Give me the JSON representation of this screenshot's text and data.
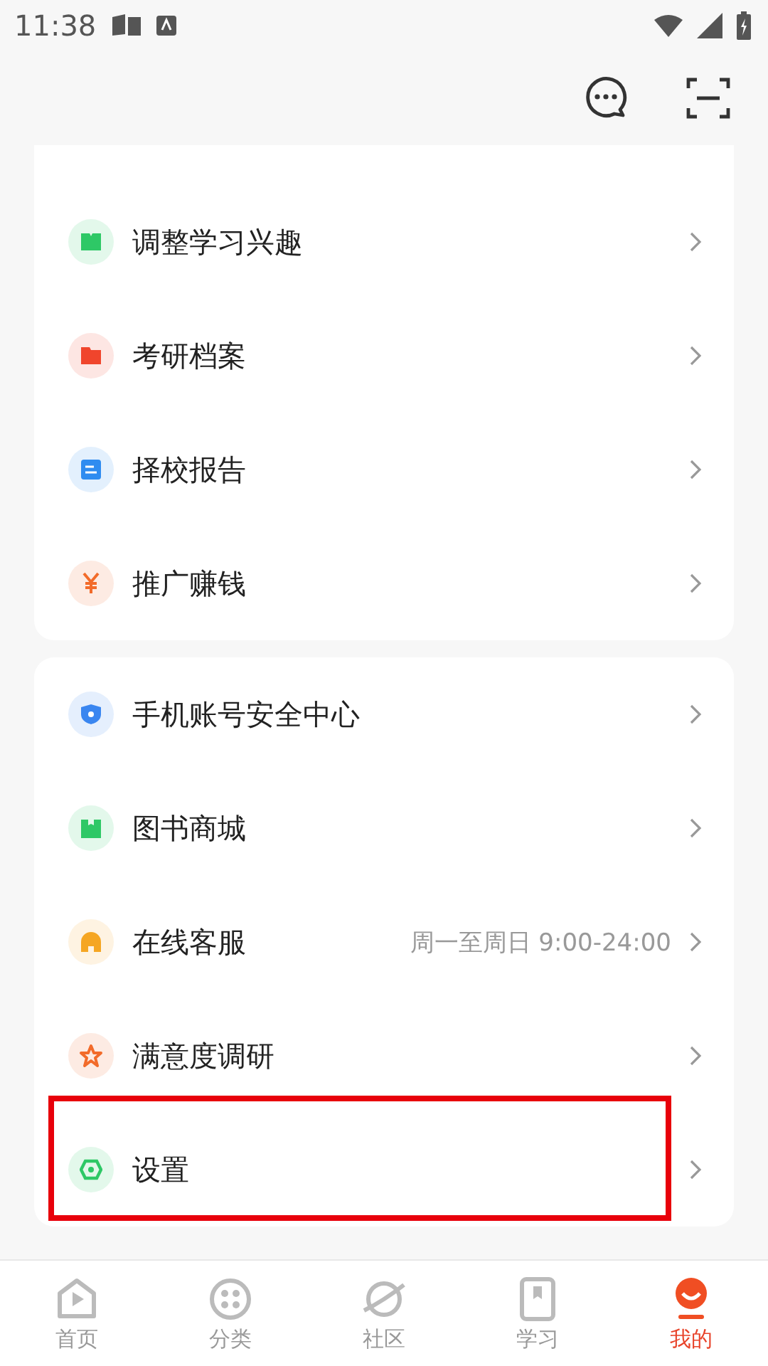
{
  "status_bar": {
    "time": "11:38"
  },
  "group_1": [
    {
      "label": "调整学习兴趣",
      "color": "#2ec866"
    },
    {
      "label": "考研档案",
      "color": "#f0452c"
    },
    {
      "label": "择校报告",
      "color": "#2f8cf0"
    },
    {
      "label": "推广赚钱",
      "color": "#f26b2a"
    }
  ],
  "group_2": [
    {
      "label": "手机账号安全中心",
      "color": "#3a86f0",
      "highlighted": false
    },
    {
      "label": "图书商城",
      "color": "#2ec866",
      "highlighted": false
    },
    {
      "label": "在线客服",
      "color": "#f5a623",
      "detail": "周一至周日 9:00-24:00",
      "highlighted": false
    },
    {
      "label": "满意度调研",
      "color": "#f26b2a",
      "highlighted": false
    },
    {
      "label": "设置",
      "color": "#2ec866",
      "highlighted": true
    }
  ],
  "tabs": [
    {
      "label": "首页",
      "selected": false
    },
    {
      "label": "分类",
      "selected": false
    },
    {
      "label": "社区",
      "selected": false
    },
    {
      "label": "学习",
      "selected": false
    },
    {
      "label": "我的",
      "selected": true
    }
  ]
}
